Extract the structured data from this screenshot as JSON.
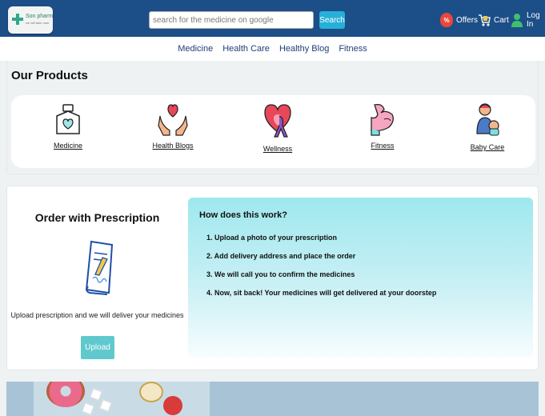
{
  "header": {
    "logo": {
      "brand": "Son pharm",
      "tagline": "we will take care"
    },
    "search": {
      "placeholder": "search for the medicine on google",
      "button_label": "Search"
    },
    "nav": {
      "offers_label": "Offers",
      "offers_icon_text": "%",
      "cart_label": "Cart",
      "login_label": "Log In"
    }
  },
  "subnav": {
    "items": [
      "Medicine",
      "Health Care",
      "Healthy Blog",
      "Fitness"
    ]
  },
  "products": {
    "title": "Our Products",
    "items": [
      {
        "label": "Medicine",
        "icon": "medicine-bottle-icon"
      },
      {
        "label": "Health Blogs",
        "icon": "hands-heart-icon"
      },
      {
        "label": "Wellness",
        "icon": "heart-ribbon-icon"
      },
      {
        "label": "Fitness",
        "icon": "arm-muscle-icon"
      },
      {
        "label": "Baby Care",
        "icon": "baby-care-icon"
      }
    ]
  },
  "prescription": {
    "title": "Order with Prescription",
    "note": "Upload prescription and we will deliver your medicines",
    "upload_label": "Upload",
    "how_title": "How does this work?",
    "steps": [
      "1. Upload a photo of your prescription",
      "2. Add delivery address and place the order",
      "3. We will call you to confirm the medicines",
      "4. Now, sit back! Your medicines will get delivered at your doorstep"
    ]
  },
  "colors": {
    "header_bg": "#1c4e88",
    "accent": "#26b0d9",
    "upload_button": "#5fc9cd"
  }
}
